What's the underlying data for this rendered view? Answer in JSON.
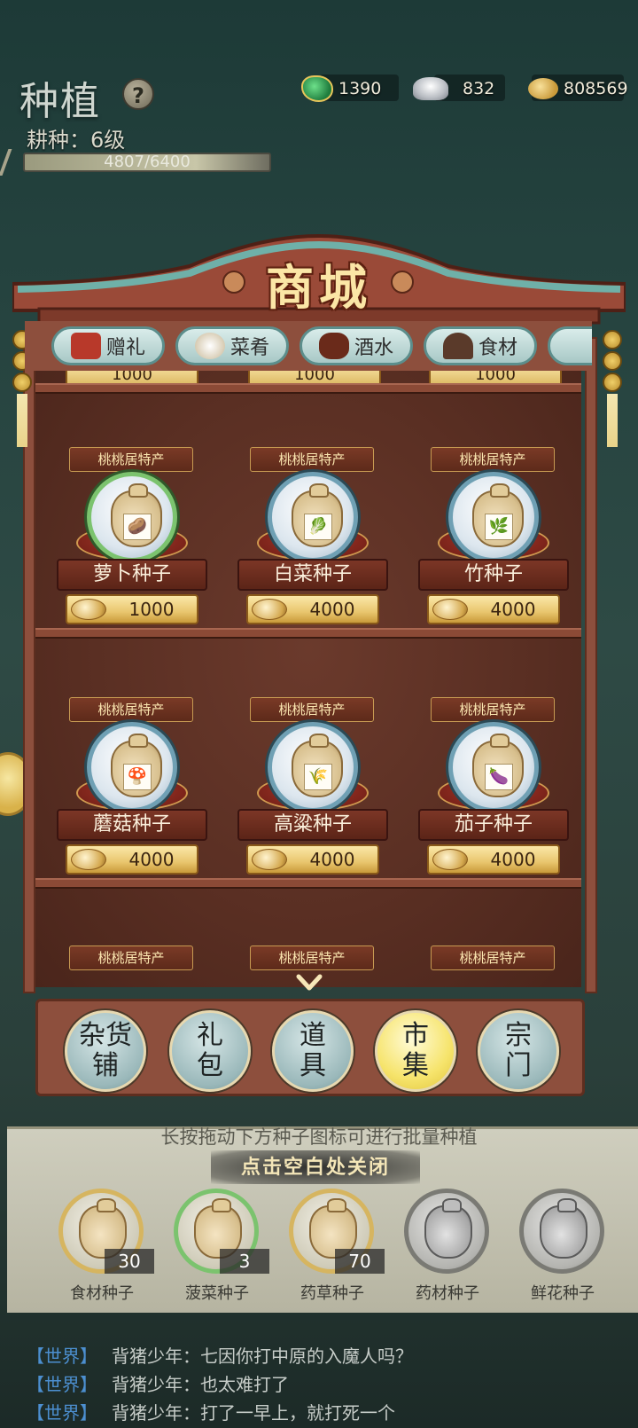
{
  "hud": {
    "title": "种植",
    "level": "耕种：6级",
    "xp": "4807/6400"
  },
  "currency": {
    "jade": "1390",
    "silver": "832",
    "coin": "808569"
  },
  "shop": {
    "title": "商城",
    "tabs": [
      {
        "label": "赠礼",
        "icon": "gift-box-icon"
      },
      {
        "label": "菜肴",
        "icon": "dish-icon"
      },
      {
        "label": "酒水",
        "icon": "wine-jar-icon"
      },
      {
        "label": "食材",
        "icon": "ingredient-bowl-icon"
      }
    ],
    "partial_prices": [
      "1000",
      "1000",
      "1000"
    ],
    "specialty_label": "桃桃居特产",
    "items": [
      {
        "name": "萝卜种子",
        "price": "1000",
        "glyph": "🥔"
      },
      {
        "name": "白菜种子",
        "price": "4000",
        "glyph": "🥬"
      },
      {
        "name": "竹种子",
        "price": "4000",
        "glyph": "🌿"
      },
      {
        "name": "蘑菇种子",
        "price": "4000",
        "glyph": "🍄"
      },
      {
        "name": "高粱种子",
        "price": "4000",
        "glyph": "🌾"
      },
      {
        "name": "茄子种子",
        "price": "4000",
        "glyph": "🍆"
      }
    ],
    "categories": [
      {
        "line1": "杂货",
        "line2": "铺"
      },
      {
        "line1": "礼",
        "line2": "包"
      },
      {
        "line1": "道",
        "line2": "具"
      },
      {
        "line1": "市",
        "line2": "集"
      },
      {
        "line1": "宗",
        "line2": "门"
      }
    ],
    "active_category": "市集"
  },
  "tray": {
    "hint": "长按拖动下方种子图标可进行批量种植",
    "close_hint": "点击空白处关闭",
    "seeds": [
      {
        "name": "食材种子",
        "count": "30"
      },
      {
        "name": "菠菜种子",
        "count": "3"
      },
      {
        "name": "药草种子",
        "count": "70"
      },
      {
        "name": "药材种子",
        "count": ""
      },
      {
        "name": "鲜花种子",
        "count": ""
      }
    ]
  },
  "chat": [
    {
      "channel": "【世界】",
      "text": "背猪少年：七因你打中原的入魔人吗？"
    },
    {
      "channel": "【世界】",
      "text": "背猪少年：也太难打了"
    },
    {
      "channel": "【世界】",
      "text": "背猪少年：打了一早上，就打死一个"
    }
  ],
  "colors": {
    "cabinet": "#9a5a46",
    "price_gold": "#e9c66e",
    "active_category": "#f6e46c",
    "chat_channel": "#4c8fd0"
  }
}
